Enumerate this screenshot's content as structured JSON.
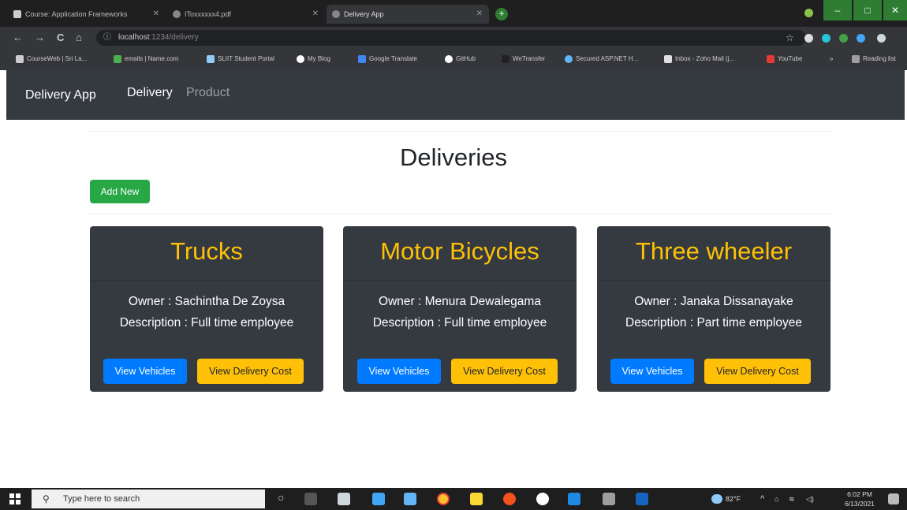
{
  "browser": {
    "tabs": [
      {
        "title": "Course: Application Frameworks",
        "active": false
      },
      {
        "title": "IToxxxxxx4.pdf",
        "active": false
      },
      {
        "title": "Delivery App",
        "active": true
      }
    ],
    "new_tab_label": "+",
    "window_controls": {
      "minimize": "–",
      "maximize": "□",
      "close": "✕"
    },
    "url_host": "localhost",
    "url_path": ":1234/delivery",
    "nav_back": "←",
    "nav_forward": "→",
    "nav_reload": "C",
    "nav_home": "⌂",
    "info_icon": "ⓘ",
    "star_icon": "☆",
    "bookmarks": [
      {
        "label": "CourseWeb | Sri La...",
        "color": "#cccccc"
      },
      {
        "label": "emails | Name.com",
        "color": "#4caf50"
      },
      {
        "label": "SLIIT Student Portal",
        "color": "#90caf9"
      },
      {
        "label": "My Blog",
        "color": "#ffffff"
      },
      {
        "label": "Google Translate",
        "color": "#4285f4"
      },
      {
        "label": "GitHub",
        "color": "#ffffff"
      },
      {
        "label": "WeTransfer",
        "color": "#222222"
      },
      {
        "label": "Secured ASP.NET H...",
        "color": "#64b5f6"
      },
      {
        "label": "Inbox - Zoho Mail (j...",
        "color": "#e0e0e0"
      },
      {
        "label": "YouTube",
        "color": "#e53935"
      }
    ],
    "bookmarks_more": "»",
    "reading_list": "Reading list"
  },
  "navbar": {
    "brand": "Delivery App",
    "links": [
      {
        "label": "Delivery",
        "active": true
      },
      {
        "label": "Product",
        "active": false
      }
    ]
  },
  "page": {
    "title": "Deliveries",
    "add_button": "Add New",
    "cards": [
      {
        "title": "Trucks",
        "owner": "Owner : Sachintha De Zoysa",
        "description": "Description : Full time employee",
        "btn_vehicles": "View Vehicles",
        "btn_cost": "View Delivery Cost"
      },
      {
        "title": "Motor Bicycles",
        "owner": "Owner : Menura Dewalegama",
        "description": "Description : Full time employee",
        "btn_vehicles": "View Vehicles",
        "btn_cost": "View Delivery Cost"
      },
      {
        "title": "Three wheeler",
        "owner": "Owner : Janaka Dissanayake",
        "description": "Description : Part time employee",
        "btn_vehicles": "View Vehicles",
        "btn_cost": "View Delivery Cost"
      }
    ]
  },
  "taskbar": {
    "search_placeholder": "Type here to search",
    "temperature": "82°F",
    "time": "6:02 PM",
    "date": "6/13/2021"
  },
  "colors": {
    "navbar_bg": "#343a40",
    "card_title": "#ffc107",
    "btn_primary": "#007bff",
    "btn_warning": "#ffc107",
    "btn_success": "#28a745"
  }
}
